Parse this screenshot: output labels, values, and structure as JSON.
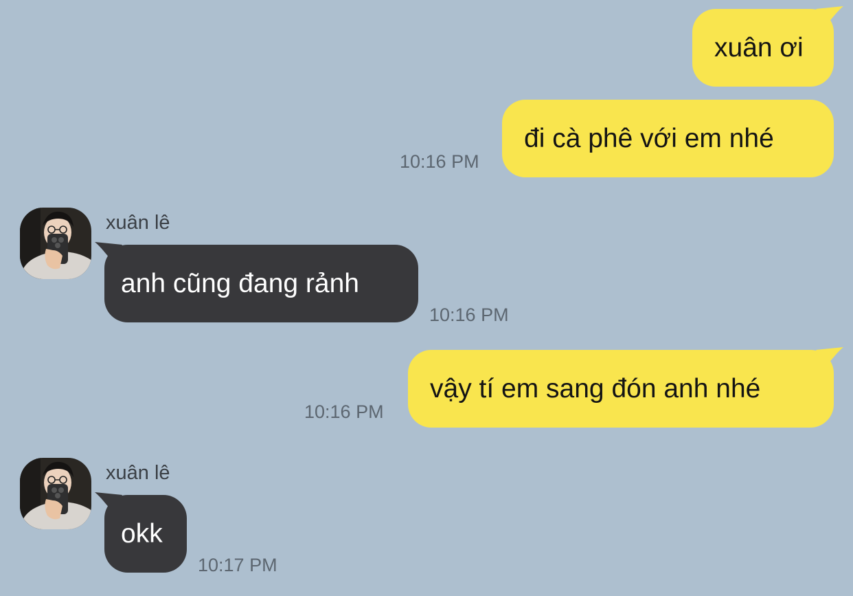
{
  "conversation": {
    "messages": [
      {
        "sender": "me",
        "text": "xuân ơi",
        "time": ""
      },
      {
        "sender": "me",
        "text": "đi cà phê với em nhé",
        "time": "10:16 PM"
      },
      {
        "sender": "xuân lê",
        "text": "anh cũng đang rảnh",
        "time": "10:16 PM"
      },
      {
        "sender": "me",
        "text": "vậy tí em sang đón anh nhé",
        "time": "10:16 PM"
      },
      {
        "sender": "xuân lê",
        "text": "okk",
        "time": "10:17 PM"
      }
    ]
  },
  "contact": {
    "name": "xuân lê",
    "avatar": "avatar-photo"
  },
  "colors": {
    "background": "#adbfcf",
    "outgoing_bubble": "#f9e54e",
    "incoming_bubble": "#38383b",
    "timestamp": "#5c6670"
  }
}
